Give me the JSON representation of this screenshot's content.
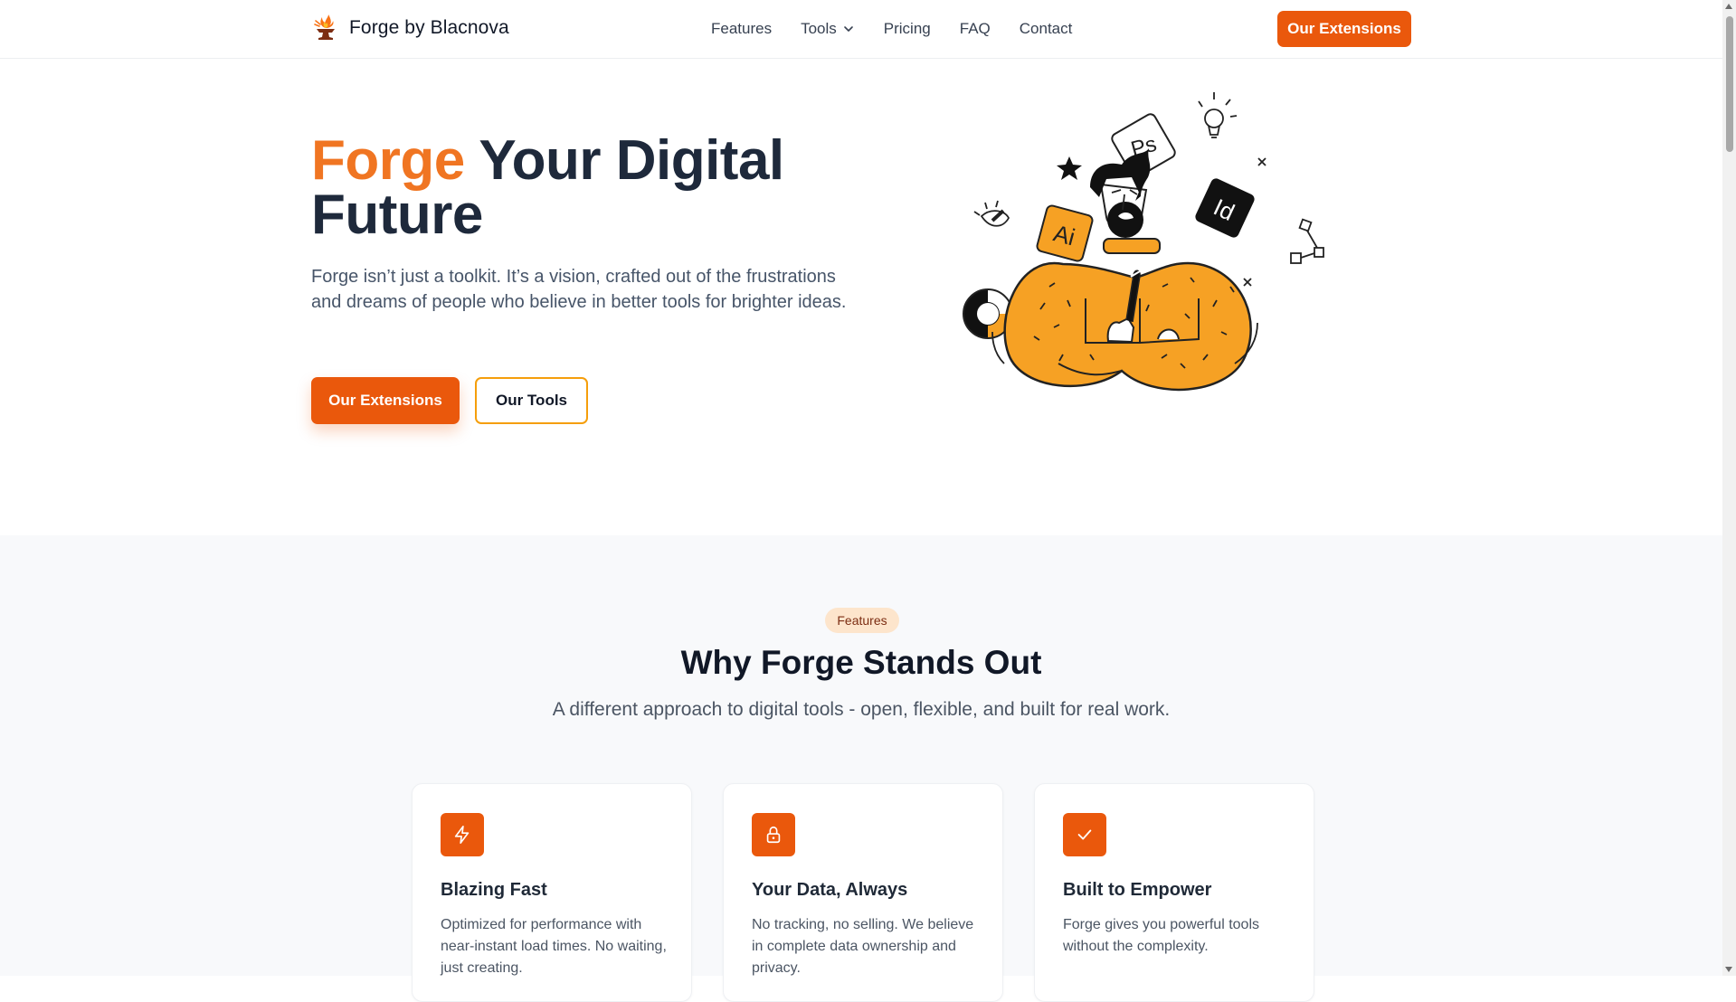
{
  "nav": {
    "brand": "Forge by Blacnova",
    "logo_icon": "forge-anvil-flame-logo",
    "links": [
      {
        "label": "Features"
      },
      {
        "label": "Tools",
        "icon": "chevron-down-icon"
      },
      {
        "label": "Pricing"
      },
      {
        "label": "FAQ"
      },
      {
        "label": "Contact"
      }
    ],
    "cta": "Our Extensions"
  },
  "hero": {
    "title_accent": "Forge",
    "title_rest": "Your Digital Future",
    "description": "Forge isn’t just a toolkit. It’s a vision, crafted out of the frustrations and dreams of people who believe in better tools for brighter ideas.",
    "primary_button": "Our Extensions",
    "secondary_button": "Our Tools",
    "illustration_labels": {
      "ps": "Ps",
      "ai": "Ai",
      "id": "Id"
    }
  },
  "features": {
    "badge": "Features",
    "title": "Why Forge Stands Out",
    "subtitle": "A different approach to digital tools - open, flexible, and built for real work.",
    "cards": [
      {
        "icon": "lightning-bolt-icon",
        "title": "Blazing Fast",
        "description": "Optimized for performance with near-instant load times. No waiting, just creating."
      },
      {
        "icon": "lock-icon",
        "title": "Your Data, Always",
        "description": "No tracking, no selling. We believe in complete data ownership and privacy."
      },
      {
        "icon": "checkmark-icon",
        "title": "Built to Empower",
        "description": "Forge gives you powerful tools without the complexity."
      }
    ]
  },
  "colors": {
    "accent": "#ea580c",
    "accent_light": "#f07522",
    "heading": "#1e293b",
    "badge_bg": "#fde5cc",
    "section_bg": "#f8f9fb"
  }
}
